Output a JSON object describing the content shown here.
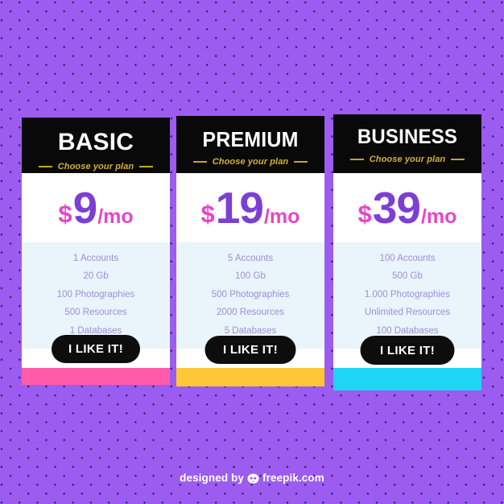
{
  "background": {
    "color": "#9c5cf0",
    "dot_color": "#3a1f6b",
    "pattern": "dotted-grid"
  },
  "plans": [
    {
      "name": "BASIC",
      "subtitle": "Choose your plan",
      "currency": "$",
      "amount": "9",
      "period": "/mo",
      "features": [
        "1 Accounts",
        "20 Gb",
        "100 Photographies",
        "500 Resources",
        "1 Databases"
      ],
      "cta_label": "I LIKE IT!",
      "accent_color": "#ff5ba8"
    },
    {
      "name": "PREMIUM",
      "subtitle": "Choose your plan",
      "currency": "$",
      "amount": "19",
      "period": "/mo",
      "features": [
        "5 Accounts",
        "100 Gb",
        "500 Photographies",
        "2000 Resources",
        "5 Databases"
      ],
      "cta_label": "I LIKE IT!",
      "accent_color": "#fdc735"
    },
    {
      "name": "BUSINESS",
      "subtitle": "Choose your plan",
      "currency": "$",
      "amount": "39",
      "period": "/mo",
      "features": [
        "100 Accounts",
        "500 Gb",
        "1.000 Photographies",
        "Unlimited Resources",
        "100 Databases"
      ],
      "cta_label": "I LIKE IT!",
      "accent_color": "#1ed5f5"
    }
  ],
  "colors": {
    "header_bg": "#090909",
    "title_text": "#ffffff",
    "subtitle_text": "#d4af3a",
    "dash": "#c9a227",
    "currency_text": "#e646c8",
    "amount_text": "#7b3fd4",
    "period_text": "#e646c8",
    "features_bg": "#e9f4fb",
    "feature_text": "#9f8fd6",
    "cta_bg": "#0d0d0d",
    "cta_text": "#ffffff"
  },
  "credit": {
    "prefix": "designed by",
    "logo": "freepik-owl-icon",
    "brand": "freepik.com"
  }
}
